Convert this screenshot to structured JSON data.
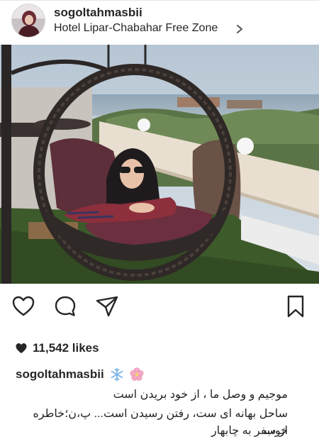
{
  "post": {
    "username": "sogoltahmasbii",
    "location": "Hotel Lipar-Chabahar Free Zone",
    "likes_text": "11,542 likes",
    "caption": {
      "username": "sogoltahmasbii",
      "line1": "موجیم و وصل ما ، از خود بریدن است",
      "line2": "ساحل بهانه ای ست، رفتن رسیدن است... پ،ن؛خاطره خوب",
      "line3": "از سفر به چابهار"
    }
  },
  "icons": {
    "like": "heart-outline-icon",
    "comment": "comment-bubble-icon",
    "share": "paper-plane-icon",
    "save": "bookmark-icon",
    "likes_indicator": "heart-filled-icon",
    "caption_emoji_1": "snowflake-icon",
    "caption_emoji_2": "blossom-icon",
    "location_chevron": "chevron-right-icon"
  },
  "colors": {
    "text": "#262626",
    "muted": "#8e8e8e",
    "blossom": "#f4a9c4",
    "snowflake": "#7fb5e6"
  }
}
